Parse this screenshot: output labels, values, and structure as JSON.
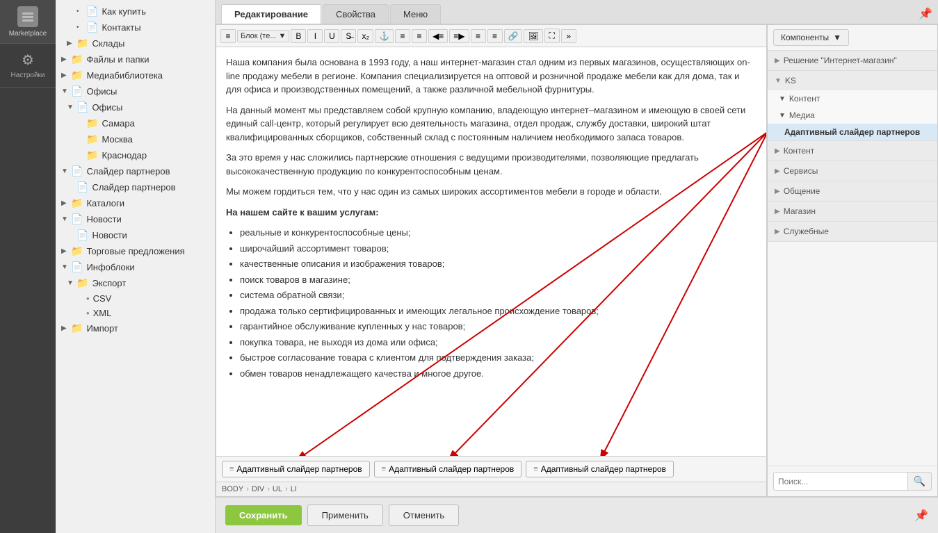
{
  "sidebar": {
    "logo_label": "Marketplace",
    "nav_items": [
      {
        "id": "settings",
        "label": "Настройки",
        "icon": "⚙"
      }
    ]
  },
  "tree": {
    "items": [
      {
        "id": "kak_kupit",
        "label": "Как купить",
        "level": 2,
        "type": "page",
        "arrow": "•"
      },
      {
        "id": "contacts",
        "label": "Контакты",
        "level": 2,
        "type": "page",
        "arrow": "•"
      },
      {
        "id": "sklady",
        "label": "Склады",
        "level": 1,
        "type": "folder",
        "arrow": "▶"
      },
      {
        "id": "faily",
        "label": "Файлы и папки",
        "level": 0,
        "type": "folder",
        "arrow": "▶"
      },
      {
        "id": "mediabib",
        "label": "Медиабиблиотека",
        "level": 0,
        "type": "folder",
        "arrow": "▶"
      },
      {
        "id": "ofisy_group",
        "label": "Офисы",
        "level": 0,
        "type": "page",
        "arrow": "▼"
      },
      {
        "id": "ofisy_sub",
        "label": "Офисы",
        "level": 1,
        "type": "page",
        "arrow": "▼"
      },
      {
        "id": "samara",
        "label": "Самара",
        "level": 2,
        "type": "folder"
      },
      {
        "id": "moskva",
        "label": "Москва",
        "level": 2,
        "type": "folder"
      },
      {
        "id": "krasnodar",
        "label": "Краснодар",
        "level": 2,
        "type": "folder"
      },
      {
        "id": "slider_group",
        "label": "Слайдер партнеров",
        "level": 0,
        "type": "page",
        "arrow": "▼"
      },
      {
        "id": "slider_sub",
        "label": "Слайдер партнеров",
        "level": 1,
        "type": "page"
      },
      {
        "id": "katalogi",
        "label": "Каталоги",
        "level": 0,
        "type": "folder",
        "arrow": "▶"
      },
      {
        "id": "novosti_group",
        "label": "Новости",
        "level": 0,
        "type": "page",
        "arrow": "▼"
      },
      {
        "id": "novosti_sub",
        "label": "Новости",
        "level": 1,
        "type": "page"
      },
      {
        "id": "torgovye",
        "label": "Торговые предложения",
        "level": 0,
        "type": "folder",
        "arrow": "▶"
      },
      {
        "id": "infobloki_group",
        "label": "Инфоблоки",
        "level": 0,
        "type": "page",
        "arrow": "▼"
      },
      {
        "id": "eksport",
        "label": "Экспорт",
        "level": 1,
        "type": "folder",
        "arrow": "▼"
      },
      {
        "id": "csv",
        "label": "CSV",
        "level": 2,
        "type": "bullet"
      },
      {
        "id": "xml",
        "label": "XML",
        "level": 2,
        "type": "bullet"
      },
      {
        "id": "import",
        "label": "Импорт",
        "level": 0,
        "type": "folder",
        "arrow": "▶"
      }
    ]
  },
  "tabs": [
    {
      "id": "edit",
      "label": "Редактирование",
      "active": true
    },
    {
      "id": "props",
      "label": "Свойства",
      "active": false
    },
    {
      "id": "menu",
      "label": "Меню",
      "active": false
    }
  ],
  "toolbar": {
    "items": [
      {
        "id": "align",
        "label": "≡",
        "type": "btn"
      },
      {
        "id": "block",
        "label": "Блок (те...",
        "type": "select"
      },
      {
        "id": "bold",
        "label": "B",
        "type": "btn"
      },
      {
        "id": "italic",
        "label": "I",
        "type": "btn"
      },
      {
        "id": "underline",
        "label": "U",
        "type": "btn"
      },
      {
        "id": "strikethrough",
        "label": "S̶",
        "type": "btn"
      },
      {
        "id": "sub",
        "label": "x₂",
        "type": "btn"
      },
      {
        "id": "anchor",
        "label": "⚓",
        "type": "btn"
      },
      {
        "id": "list_ul",
        "label": "≡",
        "type": "btn"
      },
      {
        "id": "list_ol",
        "label": "≡",
        "type": "btn"
      },
      {
        "id": "indent_dec",
        "label": "◀≡",
        "type": "btn"
      },
      {
        "id": "indent_inc",
        "label": "≡▶",
        "type": "btn"
      },
      {
        "id": "align_l",
        "label": "≡",
        "type": "btn"
      },
      {
        "id": "align_c",
        "label": "≡",
        "type": "btn"
      },
      {
        "id": "link",
        "label": "🔗",
        "type": "btn"
      },
      {
        "id": "image",
        "label": "🖼",
        "type": "btn"
      },
      {
        "id": "fullscreen",
        "label": "⛶",
        "type": "btn"
      },
      {
        "id": "more",
        "label": "»",
        "type": "btn"
      }
    ]
  },
  "content": {
    "paragraphs": [
      "Наша компания была основана в 1993 году, а наш интернет-магазин стал одним из первых магазинов, осуществляющих on-line продажу мебели в регионе. Компания специализируется на оптовой и розничной продаже мебели как для дома, так и для офиса и производственных помещений, а также различной мебельной фурнитуры.",
      "На данный момент мы представляем собой крупную компанию, владеющую интернет–магазином и имеющую в своей сети единый call-центр, который регулирует всю деятельность магазина, отдел продаж, службу доставки, широкий штат квалифицированных сборщиков, собственный склад с постоянным наличием необходимого запаса товаров.",
      "За это время у нас сложились партнерские отношения с ведущими производителями, позволяющие предлагать высококачественную продукцию по конкурентоспособным ценам.",
      "Мы можем гордиться тем, что у нас один из самых широких ассортиментов мебели в городе и области."
    ],
    "list_heading": "На нашем сайте к вашим услугам:",
    "list_items": [
      "реальные и конкурентоспособные цены;",
      "широчайший ассортимент товаров;",
      "качественные описания и изображения товаров;",
      "поиск товаров в магазине;",
      "система обратной связи;",
      "продажа только сертифицированных и имеющих легальное происхождение товаров;",
      "гарантийное обслуживание купленных у нас товаров;",
      "покупка товара, не выходя из дома или офиса;",
      "быстрое согласование товара с клиентом для подтверждения заказа;",
      "обмен товаров ненадлежащего качества и многое другое."
    ]
  },
  "bottom_components": [
    {
      "id": "comp1",
      "label": "Адаптивный слайдер партнеров"
    },
    {
      "id": "comp2",
      "label": "Адаптивный слайдер партнеров"
    },
    {
      "id": "comp3",
      "label": "Адаптивный слайдер партнеров"
    }
  ],
  "breadcrumb": {
    "items": [
      "BODY",
      "DIV",
      "UL",
      "LI"
    ]
  },
  "right_panel": {
    "dropdown_label": "Компоненты",
    "sections": [
      {
        "id": "resheniye",
        "label": "Решение \"Интернет-магазин\"",
        "expanded": false
      },
      {
        "id": "ks",
        "label": "KS",
        "expanded": true,
        "subsections": [
          {
            "id": "kontent1",
            "label": "Контент",
            "expanded": true,
            "items": []
          },
          {
            "id": "media",
            "label": "Медиа",
            "expanded": true,
            "items": [
              {
                "id": "adaptive_slider",
                "label": "Адаптивный слайдер партнеров",
                "highlighted": true
              }
            ]
          }
        ]
      },
      {
        "id": "kontent2",
        "label": "Контент",
        "expanded": false
      },
      {
        "id": "servisy",
        "label": "Сервисы",
        "expanded": false
      },
      {
        "id": "obshcheniye",
        "label": "Общение",
        "expanded": false
      },
      {
        "id": "magazin",
        "label": "Магазин",
        "expanded": false
      },
      {
        "id": "sluzhebnye",
        "label": "Служебные",
        "expanded": false
      }
    ],
    "search_placeholder": "Поиск..."
  },
  "buttons": {
    "save": "Сохранить",
    "apply": "Применить",
    "cancel": "Отменить"
  }
}
